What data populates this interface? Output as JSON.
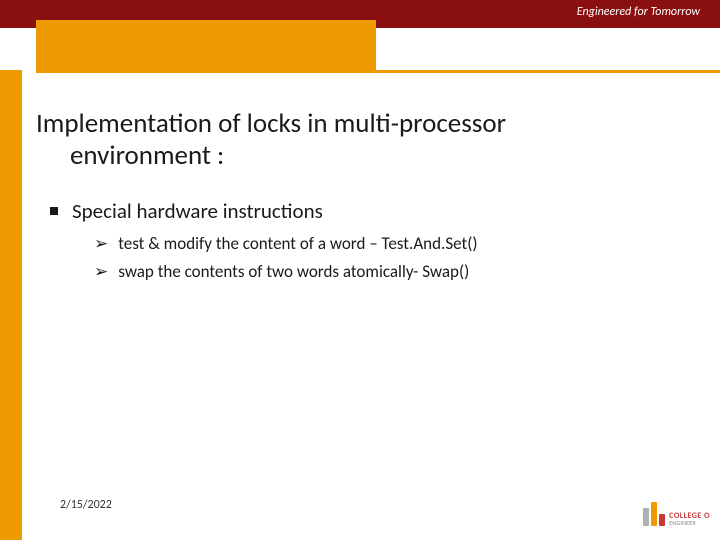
{
  "header": {
    "tagline": "Engineered for Tomorrow"
  },
  "title": {
    "line1": "Implementation of locks in multi-processor",
    "line2": "environment :"
  },
  "body": {
    "bullet1": "Special hardware instructions",
    "sub1": "test & modify the content of a word – Test.And.Set()",
    "sub2": "swap the contents of two words atomically- Swap()"
  },
  "footer": {
    "date": "2/15/2022"
  },
  "logo": {
    "line1": "COLLEGE O",
    "line2": "ENGINEER"
  }
}
